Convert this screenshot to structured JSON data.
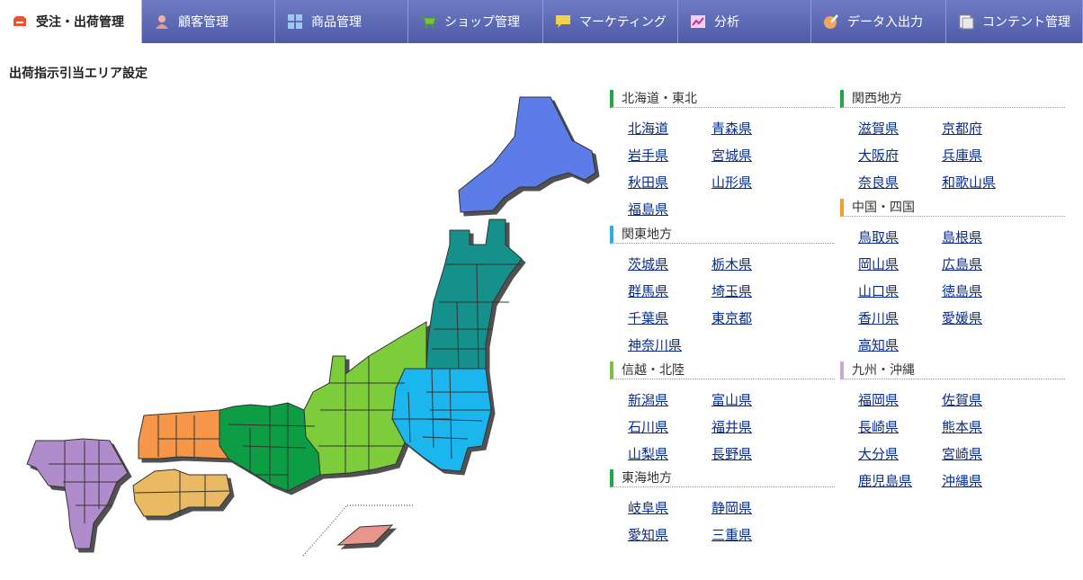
{
  "nav": {
    "tabs": [
      {
        "label": "受注・出荷管理",
        "icon": "tray-icon",
        "active": true
      },
      {
        "label": "顧客管理",
        "icon": "person-icon"
      },
      {
        "label": "商品管理",
        "icon": "grid-icon"
      },
      {
        "label": "ショップ管理",
        "icon": "cart-icon"
      },
      {
        "label": "マーケティング",
        "icon": "speech-bubble-icon"
      },
      {
        "label": "分析",
        "icon": "chart-icon"
      },
      {
        "label": "データ入出力",
        "icon": "edit-icon"
      },
      {
        "label": "コンテント管理",
        "icon": "document-icon"
      }
    ]
  },
  "page": {
    "title": "出荷指示引当エリア設定"
  },
  "regions": [
    {
      "name": "北海道・東北",
      "color": "#1fa84a",
      "prefectures": [
        "北海道",
        "青森県",
        "岩手県",
        "宮城県",
        "秋田県",
        "山形県",
        "福島県"
      ]
    },
    {
      "name": "関東地方",
      "color": "#2aaee8",
      "prefectures": [
        "茨城県",
        "栃木県",
        "群馬県",
        "埼玉県",
        "千葉県",
        "東京都",
        "神奈川県"
      ]
    },
    {
      "name": "信越・北陸",
      "color": "#7cc242",
      "prefectures": [
        "新潟県",
        "富山県",
        "石川県",
        "福井県",
        "山梨県",
        "長野県"
      ]
    },
    {
      "name": "東海地方",
      "color": "#1fa84a",
      "prefectures": [
        "岐阜県",
        "静岡県",
        "愛知県",
        "三重県"
      ]
    },
    {
      "name": "関西地方",
      "color": "#1fa84a",
      "prefectures": [
        "滋賀県",
        "京都府",
        "大阪府",
        "兵庫県",
        "奈良県",
        "和歌山県"
      ]
    },
    {
      "name": "中国・四国",
      "color": "#f0a030",
      "prefectures": [
        "鳥取県",
        "島根県",
        "岡山県",
        "広島県",
        "山口県",
        "徳島県",
        "香川県",
        "愛媛県",
        "高知県"
      ]
    },
    {
      "name": "九州・沖縄",
      "color": "#c8a8d8",
      "prefectures": [
        "福岡県",
        "佐賀県",
        "長崎県",
        "熊本県",
        "大分県",
        "宮崎県",
        "鹿児島県",
        "沖縄県"
      ]
    }
  ],
  "map": {
    "colors": {
      "hokkaido": "#5b7be8",
      "tohoku": "#17908a",
      "kanto": "#1ab6ef",
      "chubu": "#7ccc3a",
      "kansai": "#0c9e44",
      "chugoku": "#f5964a",
      "shikoku": "#eab964",
      "kyushu": "#b08ccc",
      "okinawa": "#e8968c"
    }
  }
}
